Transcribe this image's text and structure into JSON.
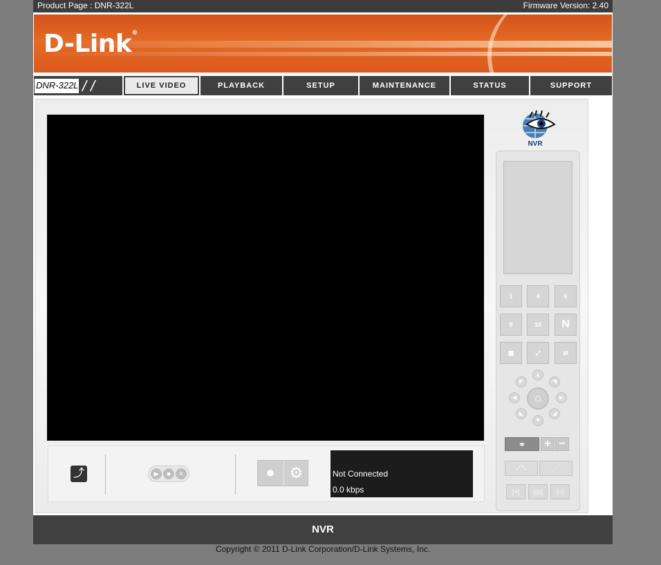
{
  "topbar": {
    "product_page": "Product Page : DNR-322L",
    "firmware": "Firmware Version: 2.40"
  },
  "brand": {
    "logo_text": "D-Link",
    "trademark": "®"
  },
  "nav": {
    "model": "DNR-322L",
    "tabs": [
      "LIVE VIDEO",
      "PLAYBACK",
      "SETUP",
      "MAINTENANCE",
      "STATUS",
      "SUPPORT"
    ],
    "active_tab": "LIVE VIDEO"
  },
  "nvr_logo": {
    "label": "NVR",
    "icon": "eye-globe-icon"
  },
  "layout_buttons": [
    "1",
    "4",
    "6",
    "9",
    "16",
    "N"
  ],
  "status": {
    "connection": "Not Connected",
    "bitrate": "0.0 kbps"
  },
  "footer": {
    "title": "NVR",
    "copyright": "Copyright © 2011 D-Link Corporation/D-Link Systems, Inc."
  },
  "colors": {
    "brand_orange": "#e36a26",
    "nav_dark": "#404040",
    "video_bg": "#000000"
  }
}
